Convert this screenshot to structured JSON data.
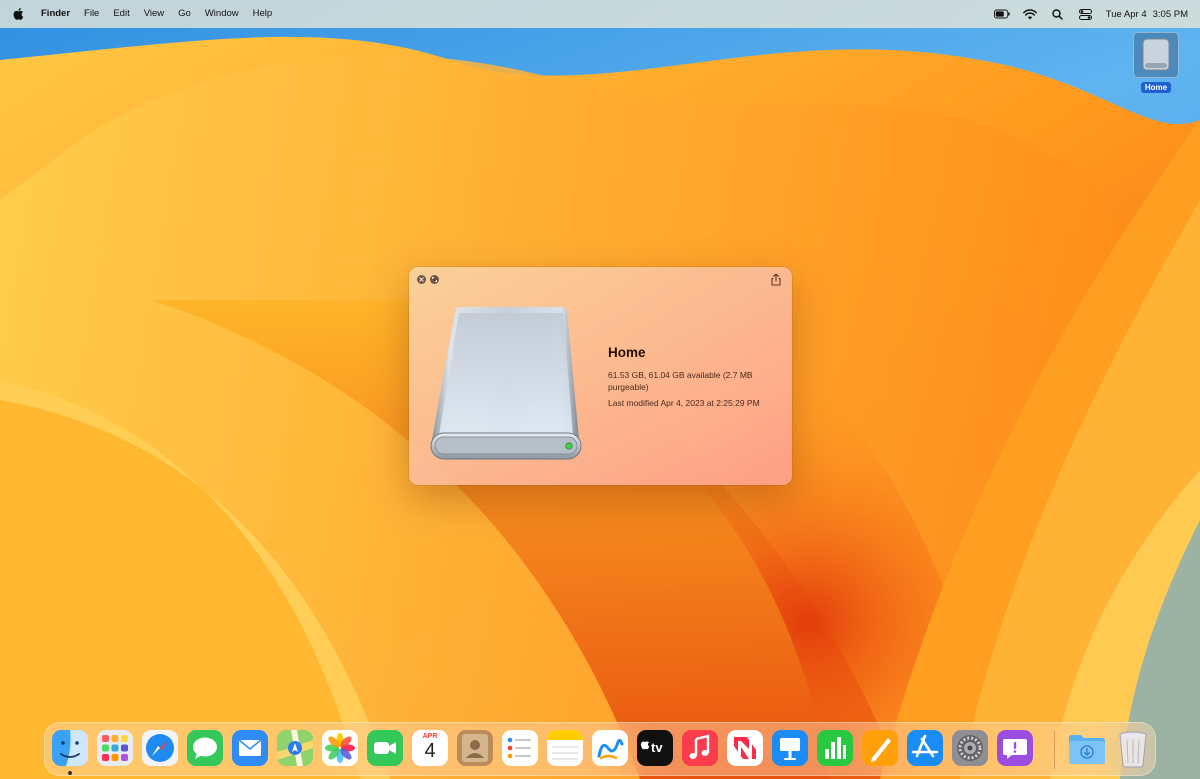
{
  "menubar": {
    "app_name": "Finder",
    "menus": [
      "File",
      "Edit",
      "View",
      "Go",
      "Window",
      "Help"
    ],
    "status_icons": [
      "battery-icon",
      "wifi-icon",
      "search-icon",
      "control-center-icon"
    ],
    "clock_date": "Tue Apr 4",
    "clock_time": "3:05 PM"
  },
  "desktop": {
    "icon_label": "Home"
  },
  "quicklook": {
    "title": "Home",
    "capacity": "61.53 GB, 61.04 GB available (2.7 MB purgeable)",
    "modified": "Last modified Apr 4, 2023 at 2:25:29 PM"
  },
  "dock": {
    "apps": [
      "Finder",
      "Launchpad",
      "Safari",
      "Messages",
      "Mail",
      "Maps",
      "Photos",
      "FaceTime",
      "Calendar",
      "Contacts",
      "Reminders",
      "Notes",
      "Freeform",
      "TV",
      "Music",
      "News",
      "Keynote",
      "Numbers",
      "Pages",
      "App Store",
      "System Settings",
      "Feedback Assistant",
      "Downloads",
      "Trash"
    ],
    "calendar_month": "APR",
    "calendar_day": "4",
    "tv_label": "tv"
  },
  "colors": {
    "selection": "#1f5fd1",
    "wallpaper_orange": "#f7a21b",
    "wallpaper_blue": "#3a8fd8"
  }
}
